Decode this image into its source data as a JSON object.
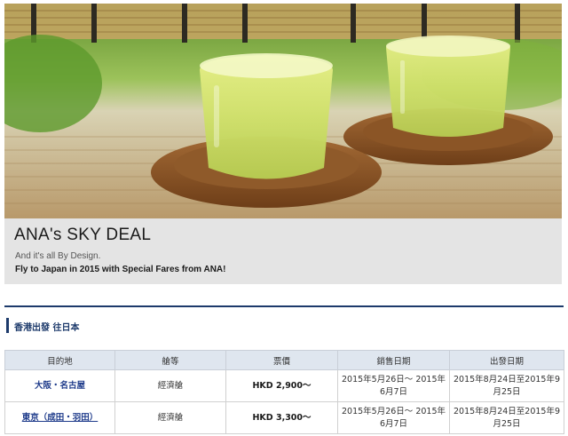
{
  "banner": {
    "title": "ANA's SKY DEAL",
    "subtitle": "And it's all By Design.",
    "tagline": "Fly to Japan in 2015 with Special Fares from ANA!"
  },
  "section": {
    "title": "香港出發 往日本"
  },
  "table": {
    "headers": [
      "目的地",
      "艙等",
      "票價",
      "銷售日期",
      "出發日期"
    ],
    "rows": [
      {
        "destination": "大阪・名古屋",
        "cabin": "經濟艙",
        "fare": "HKD 2,900～",
        "sales_period": "2015年5月26日～ 2015年6月7日",
        "travel_period": "2015年8月24日至2015年9月25日"
      },
      {
        "destination": "東京（成田・羽田）",
        "cabin": "經濟艙",
        "fare": "HKD 3,300～",
        "sales_period": "2015年5月26日～ 2015年6月7日",
        "travel_period": "2015年8月24日至2015年9月25日"
      }
    ]
  },
  "colors": {
    "accent": "#1d3a6b",
    "header_bg": "#dfe6ef",
    "caption_bg": "#e4e4e4"
  }
}
